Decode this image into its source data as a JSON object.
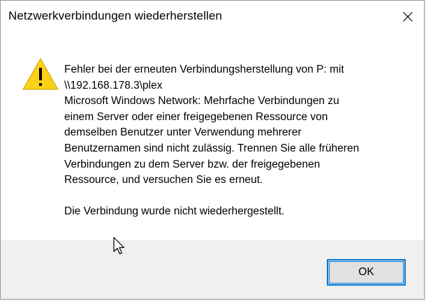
{
  "dialog": {
    "title": "Netzwerkverbindungen wiederherstellen",
    "close_icon": "close-icon",
    "warning_icon": "warning-icon",
    "message_lines": [
      "Fehler bei der erneuten Verbindungsherstellung von P: mit",
      "\\\\192.168.178.3\\plex",
      "Microsoft Windows Network: Mehrfache Verbindungen zu",
      "einem Server oder einer freigegebenen Ressource von",
      "demselben Benutzer unter Verwendung mehrerer",
      "Benutzernamen sind nicht zulässig. Trennen Sie alle früheren",
      "Verbindungen zu dem Server bzw. der freigegebenen",
      "Ressource, und versuchen Sie es erneut."
    ],
    "footer_message": "Die Verbindung wurde nicht wiederhergestellt.",
    "ok_label": "OK"
  },
  "colors": {
    "accent": "#0078d7",
    "warning_fill": "#fcd116",
    "footer_bg": "#f0f0f0"
  }
}
